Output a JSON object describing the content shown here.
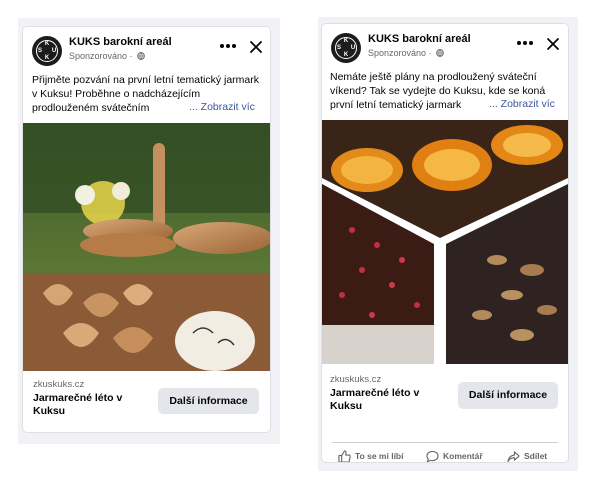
{
  "ads": [
    {
      "page_name": "KUKS barokní areál",
      "sponsored": "Sponzorováno ·",
      "body_text": "Přijměte pozvání na první letní tematický jarmark v Kuksu! Proběhne o nadcházejícím prodlouženém svátečním",
      "see_more": "... Zobrazit víc",
      "image_alt": "Wooden bowls, hearts and a painted stone on a garden table",
      "domain": "zkuskuks.cz",
      "headline": "Jarmarečné léto v Kuksu",
      "cta": "Další informace"
    },
    {
      "page_name": "KUKS barokní areál",
      "sponsored": "Sponzorováno ·",
      "body_text": "Nemáte ještě plány na prodloužený sváteční víkend? Tak se vydejte do Kuksu, kde se koná první letní tematický jarmark",
      "see_more": "... Zobrazit víc",
      "image_alt": "Collage of candied orange slices and dark chocolate bars",
      "domain": "zkuskuks.cz",
      "headline": "Jarmarečné léto v Kuksu",
      "cta": "Další informace",
      "actions": {
        "like": "To se mi líbí",
        "comment": "Komentář",
        "share": "Sdílet"
      }
    }
  ],
  "logo_letters": [
    "K",
    "S",
    "U",
    "K"
  ],
  "colors": {
    "link": "#385898",
    "cta_bg": "#e4e6eb",
    "secondary_text": "#65676b",
    "page_bg": "#f0f2f5"
  }
}
